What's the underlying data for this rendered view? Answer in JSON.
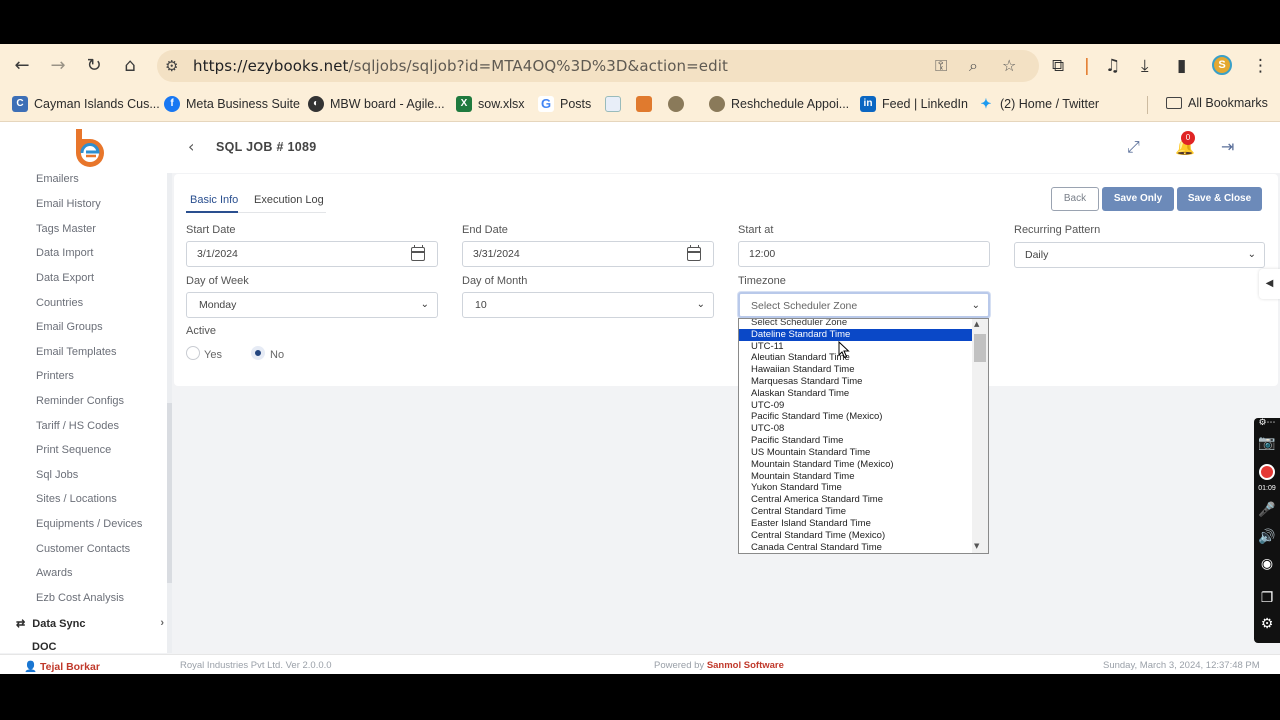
{
  "browser": {
    "url_host": "https://ezybooks.net",
    "url_path": "/sqljobs/sqljob?id=MTA4OQ%3D%3D&action=edit",
    "bookmarks": [
      {
        "label": "Cayman Islands Cus..."
      },
      {
        "label": "Meta Business Suite"
      },
      {
        "label": "MBW board - Agile..."
      },
      {
        "label": "sow.xlsx"
      },
      {
        "label": "Posts"
      },
      {
        "label": "Reshchedule Appoi..."
      },
      {
        "label": "Feed | LinkedIn"
      },
      {
        "label": "(2) Home / Twitter"
      },
      {
        "label": "All Bookmarks"
      }
    ],
    "profile_initial": "S"
  },
  "header": {
    "title": "SQL JOB # 1089",
    "notification_count": "0"
  },
  "sidebar": {
    "items": [
      {
        "label": "Emailers"
      },
      {
        "label": "Email History"
      },
      {
        "label": "Tags Master"
      },
      {
        "label": "Data Import"
      },
      {
        "label": "Data Export"
      },
      {
        "label": "Countries"
      },
      {
        "label": "Email Groups"
      },
      {
        "label": "Email Templates"
      },
      {
        "label": "Printers"
      },
      {
        "label": "Reminder Configs"
      },
      {
        "label": "Tariff / HS Codes"
      },
      {
        "label": "Print Sequence"
      },
      {
        "label": "Sql Jobs"
      },
      {
        "label": "Sites / Locations"
      },
      {
        "label": "Equipments / Devices"
      },
      {
        "label": "Customer Contacts"
      },
      {
        "label": "Awards"
      },
      {
        "label": "Ezb Cost Analysis"
      }
    ],
    "group_data_sync": "Data Sync",
    "group_next": "DOC"
  },
  "tabs": [
    {
      "label": "Basic Info"
    },
    {
      "label": "Execution Log"
    }
  ],
  "buttons": {
    "back": "Back",
    "save_only": "Save Only",
    "save_close": "Save & Close"
  },
  "form": {
    "start_date_label": "Start Date",
    "start_date_value": "3/1/2024",
    "end_date_label": "End Date",
    "end_date_value": "3/31/2024",
    "start_at_label": "Start at",
    "start_at_value": "12:00",
    "recurring_label": "Recurring Pattern",
    "recurring_value": "Daily",
    "day_of_week_label": "Day of Week",
    "day_of_week_value": "Monday",
    "day_of_month_label": "Day of Month",
    "day_of_month_value": "10",
    "timezone_label": "Timezone",
    "timezone_value": "Select Scheduler Zone",
    "active_label": "Active",
    "active_yes": "Yes",
    "active_no": "No",
    "active_selected": "No"
  },
  "timezone_options": [
    "Select Scheduler Zone",
    "Dateline Standard Time",
    "UTC-11",
    "Aleutian Standard Time",
    "Hawaiian Standard Time",
    "Marquesas Standard Time",
    "Alaskan Standard Time",
    "UTC-09",
    "Pacific Standard Time (Mexico)",
    "UTC-08",
    "Pacific Standard Time",
    "US Mountain Standard Time",
    "Mountain Standard Time (Mexico)",
    "Mountain Standard Time",
    "Yukon Standard Time",
    "Central America Standard Time",
    "Central Standard Time",
    "Easter Island Standard Time",
    "Central Standard Time (Mexico)",
    "Canada Central Standard Time"
  ],
  "timezone_highlighted": "Dateline Standard Time",
  "footer": {
    "user": "Tejal Borkar",
    "company": "Royal Industries Pvt Ltd. Ver 2.0.0.0",
    "powered_prefix": "Powered by",
    "powered_brand": "Sanmol Software",
    "datetime": "Sunday, March 3, 2024, 12:37:48 PM"
  },
  "recorder": {
    "time": "01:09"
  }
}
